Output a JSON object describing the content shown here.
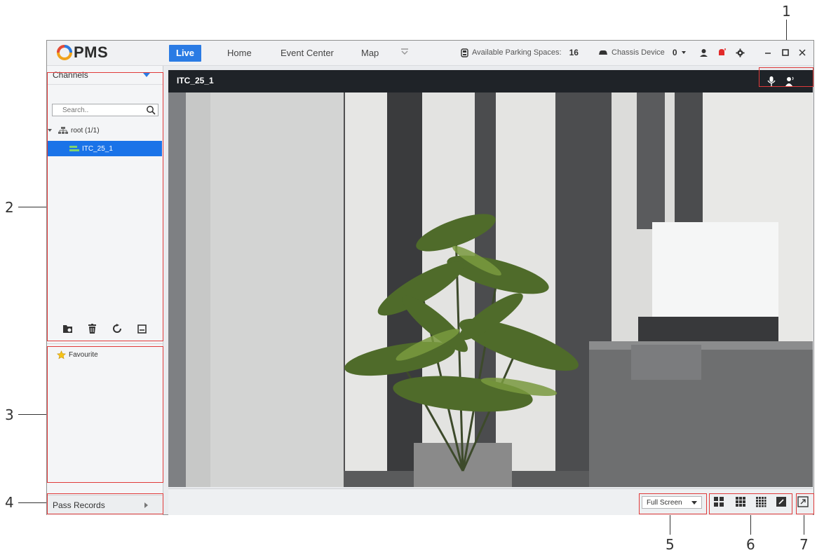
{
  "app": {
    "logo_text": "PMS",
    "tabs": [
      {
        "label": "Live",
        "active": true
      },
      {
        "label": "Home",
        "active": false
      },
      {
        "label": "Event Center",
        "active": false
      },
      {
        "label": "Map",
        "active": false
      }
    ],
    "more_tabs_icon": "double-chevron-down-icon",
    "parking": {
      "label": "Available Parking Spaces:",
      "value": "16"
    },
    "chassis": {
      "label": "Chassis Device",
      "value": "0"
    },
    "accent_color": "#2a7be4"
  },
  "left_panel": {
    "channels_label": "Channels",
    "search_placeholder": "Search..",
    "tree_root": "root (1/1)",
    "tree_item": "ITC_25_1",
    "favourite_label": "Favourite",
    "pass_records_label": "Pass Records"
  },
  "video": {
    "title": "ITC_25_1"
  },
  "bottom_bar": {
    "full_screen_label": "Full Screen"
  },
  "callouts": {
    "c1": "1",
    "c2": "2",
    "c3": "3",
    "c4": "4",
    "c5": "5",
    "c6": "6",
    "c7": "7"
  }
}
